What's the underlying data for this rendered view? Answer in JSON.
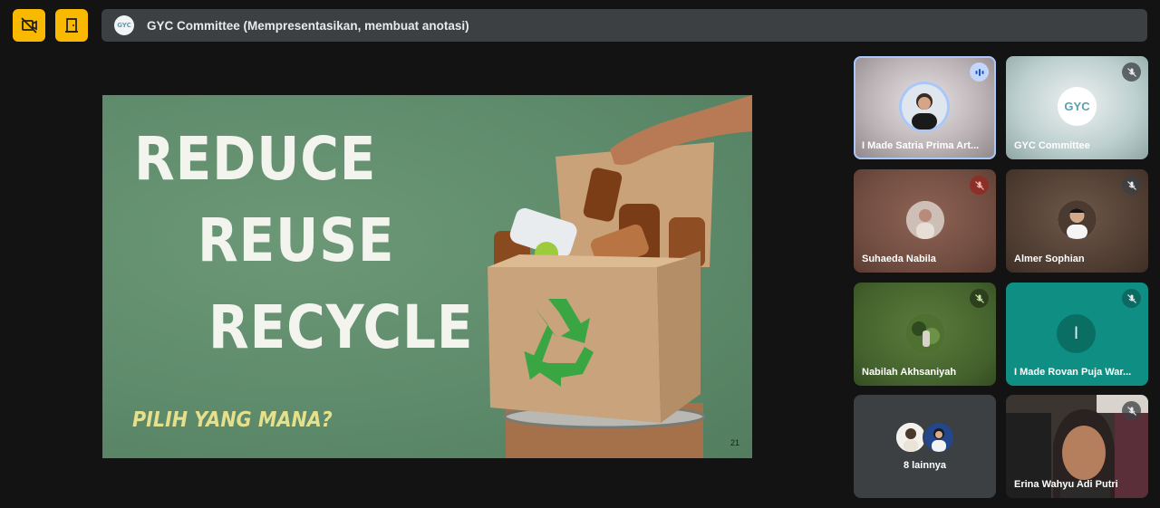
{
  "toolbar": {
    "hide_video_label": "",
    "leave_label": ""
  },
  "presentation": {
    "title": "GYC Committee (Mempresentasikan, membuat anotasi)",
    "logo_text": "GYC",
    "slide": {
      "line1": "REDUCE",
      "line2": "REUSE",
      "line3": "RECYCLE",
      "question": "PILIH YANG MANA?",
      "page_number": "21"
    }
  },
  "participants": [
    {
      "name": "I Made Satria Prima Art...",
      "speaking": true,
      "muted": false
    },
    {
      "name": "GYC Committee",
      "speaking": false,
      "muted": true,
      "logo_text": "GYC"
    },
    {
      "name": "Suhaeda Nabila",
      "speaking": false,
      "muted": true
    },
    {
      "name": "Almer Sophian",
      "speaking": false,
      "muted": true
    },
    {
      "name": "Nabilah Akhsaniyah",
      "speaking": false,
      "muted": true
    },
    {
      "name": "I Made Rovan Puja War...",
      "speaking": false,
      "muted": true,
      "initial": "I"
    },
    {
      "name": "Erina Wahyu Adi Putri",
      "speaking": false,
      "muted": true
    }
  ],
  "others": {
    "label": "8 lainnya"
  },
  "colors": {
    "accent": "#f9b900",
    "bar": "#3c4043",
    "slide_bg": "#5e8b6b",
    "active_border": "#a8c7fa",
    "teal_tile": "#0f8f84"
  }
}
